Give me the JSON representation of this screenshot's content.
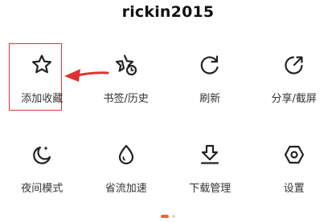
{
  "username": "rickin2015",
  "accent_color": "#e0332f",
  "page_indicator": {
    "current": 1,
    "total": 2
  },
  "menu": {
    "row1": [
      {
        "label": "添加收藏",
        "icon": "star-icon"
      },
      {
        "label": "书签/历史",
        "icon": "star-clock-icon"
      },
      {
        "label": "刷新",
        "icon": "refresh-icon"
      },
      {
        "label": "分享/截屏",
        "icon": "share-icon"
      }
    ],
    "row2": [
      {
        "label": "夜间模式",
        "icon": "moon-icon"
      },
      {
        "label": "省流加速",
        "icon": "drop-icon"
      },
      {
        "label": "下载管理",
        "icon": "download-icon"
      },
      {
        "label": "设置",
        "icon": "settings-icon"
      }
    ]
  }
}
